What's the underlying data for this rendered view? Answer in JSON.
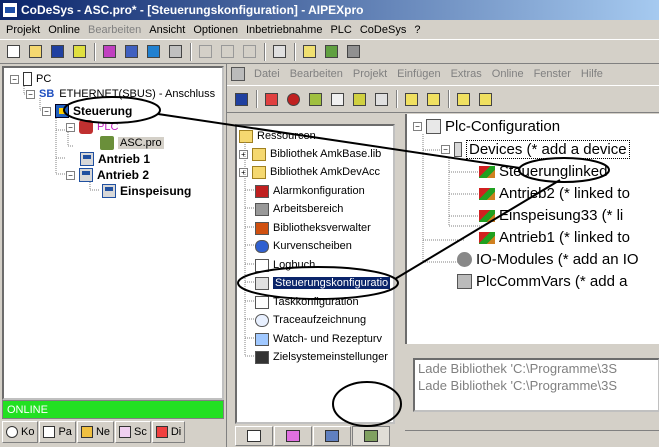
{
  "window": {
    "title": "CoDeSys - ASC.pro* - [Steuerungskonfiguration] - AIPEXpro"
  },
  "menu": [
    {
      "label": "Projekt",
      "disabled": false
    },
    {
      "label": "Online",
      "disabled": false
    },
    {
      "label": "Bearbeiten",
      "disabled": true
    },
    {
      "label": "Ansicht",
      "disabled": false
    },
    {
      "label": "Optionen",
      "disabled": false
    },
    {
      "label": "Inbetriebnahme",
      "disabled": false
    },
    {
      "label": "PLC",
      "disabled": false
    },
    {
      "label": "CoDeSys",
      "disabled": false
    },
    {
      "label": "?",
      "disabled": false
    }
  ],
  "tree": {
    "pc": "PC",
    "ethernet_tag": "SB",
    "ethernet": "ETHERNET(SBUS) - Anschluss",
    "steuerung": "Steuerung",
    "plc": "PLC",
    "asc": "ASC.pro",
    "antrieb1": "Antrieb 1",
    "antrieb2": "Antrieb 2",
    "einspeisung": "Einspeisung"
  },
  "status": {
    "online": "ONLINE"
  },
  "left_tabs": [
    "Ko",
    "Pa",
    "Ne",
    "Sc",
    "Di"
  ],
  "child_menu": [
    "Datei",
    "Bearbeiten",
    "Projekt",
    "Einfügen",
    "Extras",
    "Online",
    "Fenster",
    "Hilfe"
  ],
  "resources": {
    "root": "Ressourcen",
    "items": [
      {
        "label": "Bibliothek AmkBase.lib",
        "icon": "folder-icon"
      },
      {
        "label": "Bibliothek AmkDevAcc",
        "icon": "folder-icon"
      },
      {
        "label": "Alarmkonfiguration",
        "icon": "alarm-icon"
      },
      {
        "label": "Arbeitsbereich",
        "icon": "tools-icon"
      },
      {
        "label": "Bibliotheksverwalter",
        "icon": "books-icon"
      },
      {
        "label": "Kurvenscheiben",
        "icon": "cam-icon"
      },
      {
        "label": "Logbuch",
        "icon": "log-icon"
      },
      {
        "label": "Steuerungskonfiguratio",
        "icon": "config-icon"
      },
      {
        "label": "Taskkonfiguration",
        "icon": "task-icon"
      },
      {
        "label": "Traceaufzeichnung",
        "icon": "trace-icon"
      },
      {
        "label": "Watch- und Rezepturv",
        "icon": "watch-icon"
      },
      {
        "label": "Zielsystemeinstellunger",
        "icon": "target-icon"
      }
    ]
  },
  "config": {
    "root": "Plc-Configuration",
    "devices": "Devices (* add a device",
    "steuerung_name": "Steuerung",
    "steuerung_rest": " linked",
    "antrieb2": "Antrieb2 (* linked to",
    "einspeisung33": "Einspeisung33 (* li",
    "antrieb1": "Antrieb1 (* linked to",
    "io_modules": "IO-Modules (* add an IO",
    "plccommvars": "PlcCommVars (* add a"
  },
  "messages": [
    "Lade Bibliothek 'C:\\Programme\\3S",
    "Lade Bibliothek 'C:\\Programme\\3S"
  ]
}
